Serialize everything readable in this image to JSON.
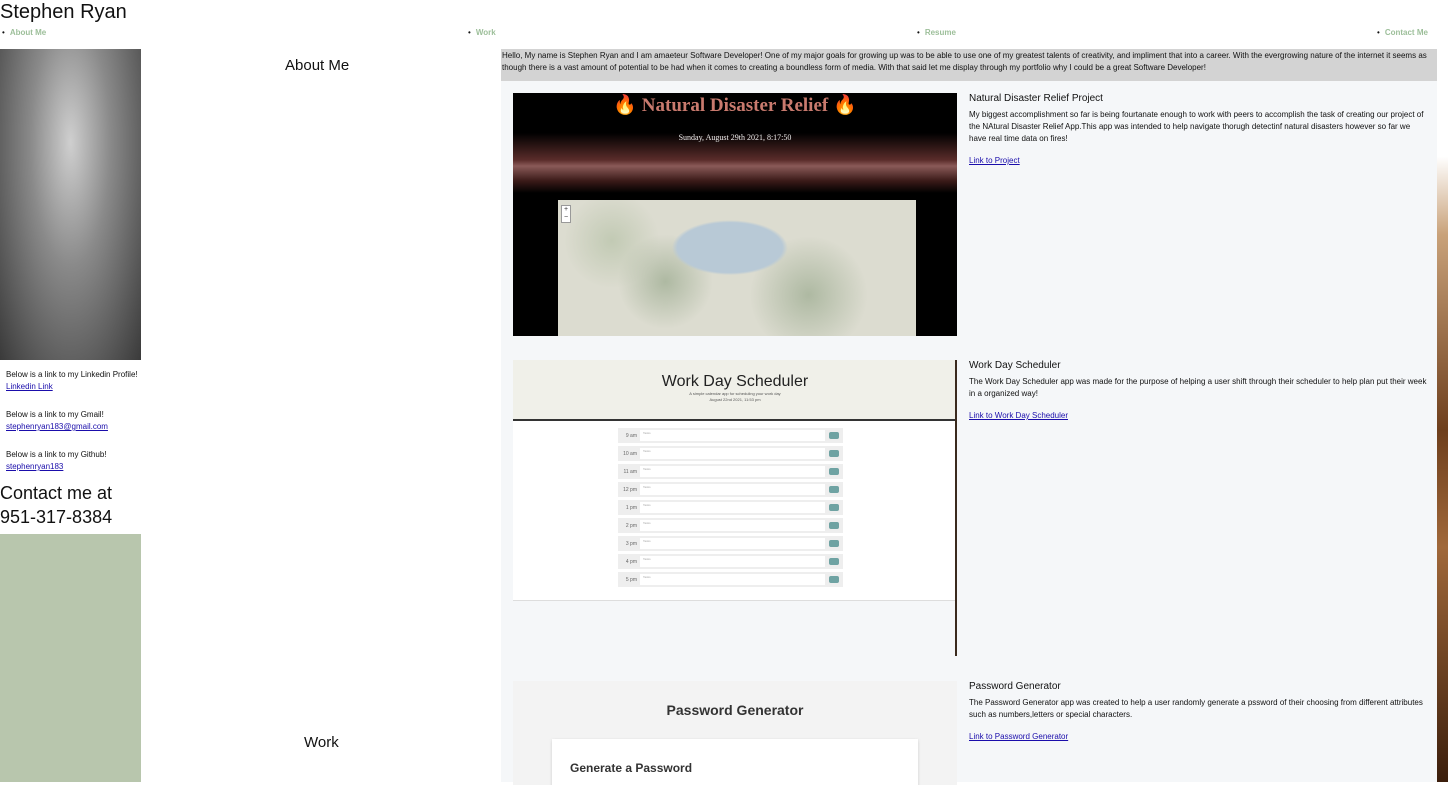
{
  "site": {
    "title": "Stephen Ryan"
  },
  "nav": {
    "items": [
      {
        "label": "About Me"
      },
      {
        "label": "Work"
      },
      {
        "label": "Resume"
      },
      {
        "label": "Contact Me"
      }
    ]
  },
  "sidebar": {
    "linkedin_text": "Below is a link to my Linkedin Profile!",
    "linkedin_link": "Linkedin Link",
    "gmail_text": "Below is a link to my Gmail!",
    "gmail_link": "stephenryan183@gmail.com",
    "github_text": "Below is a link to my Github!",
    "github_link": "stephenryan183",
    "contact_line1": "Contact me at",
    "contact_line2": "951-317-8384"
  },
  "sections": {
    "about_heading": "About Me",
    "work_heading": "Work"
  },
  "intro": {
    "text": "Hello, My name is Stephen Ryan and I am amaeteur Software Developer! One of my major goals for growing up was to be able to use one of my greatest talents of creativity, and impliment that into a career. With the evergrowing nature of the internet it seems as though there is a vast amount of potential to be had when it comes to creating a boundless form of media. With that said let me display through my portfolio why I could be a great Software Developer!"
  },
  "projects": [
    {
      "title": "Natural Disaster Relief Project",
      "description": "My biggest accomplishment so far is being fourtanate enough to work with peers to accomplish the task of creating our project of the NAtural Disaster Relief App.This app was intended to help navigate thorugh detectinf natural disasters however so far we have real time data on fires!",
      "link": "Link to Project",
      "shot": {
        "title": "🔥 Natural Disaster Relief 🔥",
        "date": "Sunday, August 29th 2021, 8:17:50"
      }
    },
    {
      "title": "Work Day Scheduler",
      "description": "The Work Day Scheduler app was made for the purpose of helping a user shift through their scheduler to help plan put their week in a organized way!",
      "link": "Link to Work Day Scheduler",
      "shot": {
        "title": "Work Day Scheduler",
        "subtitle": "A simple calendar app for scheduling your work day",
        "date": "August 22nd 2021, 11:53 pm",
        "task_placeholder": "Tasks",
        "hours": [
          "9 am",
          "10 am",
          "11 am",
          "12 pm",
          "1 pm",
          "2 pm",
          "3 pm",
          "4 pm",
          "5 pm"
        ]
      }
    },
    {
      "title": "Password Generator",
      "description": "The Password Generator app was created to help a user randomly generate a pssword of their choosing from different attributes such as numbers,letters or special characters.",
      "link": "Link to Password Generator",
      "shot": {
        "title": "Password Generator",
        "card_title": "Generate a Password"
      }
    }
  ]
}
